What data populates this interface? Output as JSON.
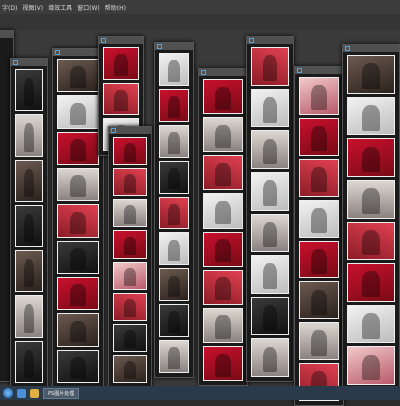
{
  "menubar": {
    "items": [
      "字(D)",
      "视图(V)",
      "增效工具",
      "窗口(W)",
      "帮助(H)"
    ]
  },
  "taskbar": {
    "task_label": "PS图片处理"
  },
  "colors": {
    "workspace": "#3a3a3a",
    "window_frame": "#1a1a1a",
    "accent_red": "#c8102e",
    "taskbar": "#2a3a4a"
  }
}
